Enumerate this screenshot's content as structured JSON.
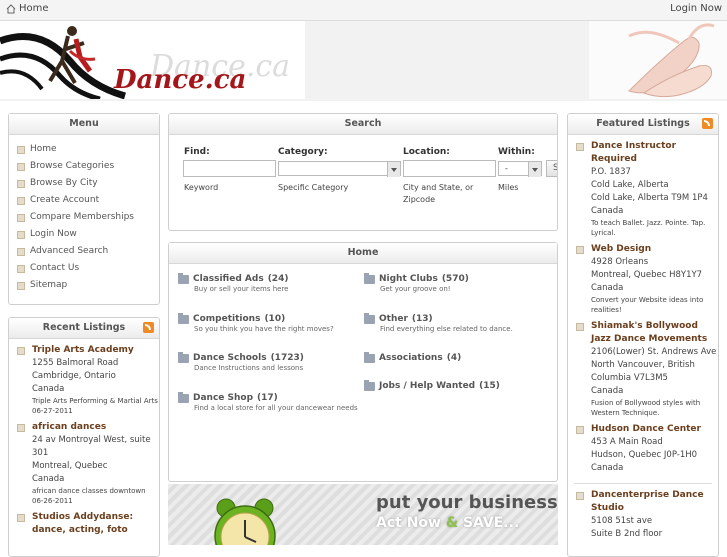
{
  "topbar": {
    "home": "Home",
    "login": "Login Now"
  },
  "logo": {
    "brand": "Dance.ca",
    "brand_shadow": "Dance.ca"
  },
  "menu": {
    "title": "Menu",
    "items": [
      "Home",
      "Browse Categories",
      "Browse By City",
      "Create Account",
      "Compare Memberships",
      "Login Now",
      "Advanced Search",
      "Contact Us",
      "Sitemap"
    ]
  },
  "recent": {
    "title": "Recent Listings",
    "items": [
      {
        "title": "Triple Arts Academy",
        "address": [
          "1255 Balmoral Road",
          "Cambridge, Ontario",
          "Canada"
        ],
        "desc": "Triple Arts Performing & Martial Arts",
        "date": "06-27-2011"
      },
      {
        "title": "african dances",
        "address": [
          "24 av Montroyal West, suite 301",
          "Montreal, Quebec",
          "Canada"
        ],
        "desc": "african dance classes downtown",
        "date": "06-26-2011"
      },
      {
        "title": "Studios Addydanse: dance, acting, foto",
        "address": [],
        "desc": "",
        "date": ""
      }
    ]
  },
  "search": {
    "title": "Search",
    "find_label": "Find:",
    "find_hint": "Keyword",
    "category_label": "Category:",
    "category_hint": "Specific Category",
    "location_label": "Location:",
    "location_hint": "City and State, or Zipcode",
    "within_label": "Within:",
    "within_value": "-",
    "within_hint": "Miles",
    "button": "Sea"
  },
  "home": {
    "title": "Home",
    "categories": [
      {
        "name": "Classified Ads",
        "count": "(24)",
        "desc": "Buy or sell your items here"
      },
      {
        "name": "Night Clubs",
        "count": "(570)",
        "desc": "Get your groove on!"
      },
      {
        "name": "Competitions",
        "count": "(10)",
        "desc": "So you think you have the right moves?"
      },
      {
        "name": "Other",
        "count": "(13)",
        "desc": "Find everything else related to dance."
      },
      {
        "name": "Dance Schools",
        "count": "(1723)",
        "desc": "Dance Instructions and lessons"
      },
      {
        "name": "Associations",
        "count": "(4)",
        "desc": ""
      },
      {
        "name": "Dance Shop",
        "count": "(17)",
        "desc": "Find a local store for all your dancewear needs"
      },
      {
        "name": "Jobs / Help Wanted",
        "count": "(15)",
        "desc": ""
      }
    ]
  },
  "banner": {
    "headline": "put your business ca",
    "cta_1": "Act Now",
    "cta_amp": "&",
    "cta_2": "SAVE..."
  },
  "featured": {
    "title": "Featured Listings",
    "items": [
      {
        "title": "Dance Instructor Required",
        "address": [
          "P.O. 1837",
          "Cold Lake, Alberta",
          "Cold Lake, Alberta T9M 1P4",
          "Canada"
        ],
        "desc": "To teach Ballet. Jazz. Pointe. Tap. Lyrical."
      },
      {
        "title": "Web Design",
        "address": [
          "4928 Orleans",
          "Montreal, Quebec H8Y1Y7",
          "Canada"
        ],
        "desc": "Convert your Website ideas into realities!"
      },
      {
        "title": "Shiamak's Bollywood Jazz Dance Movements",
        "address": [
          "2106(Lower) St. Andrews Ave",
          "North Vancouver, British Columbia V7L3M5",
          "Canada"
        ],
        "desc": "Fusion of Bollywood styles with Western Technique."
      },
      {
        "title": "Hudson Dance Center",
        "address": [
          "453 A Main Road",
          "Hudson, Quebec J0P-1H0",
          "Canada"
        ],
        "desc": ""
      },
      {
        "title": "Dancenterprise Dance Studio",
        "address": [
          "5108 51st ave",
          "Suite B 2nd floor"
        ],
        "desc": ""
      }
    ]
  }
}
